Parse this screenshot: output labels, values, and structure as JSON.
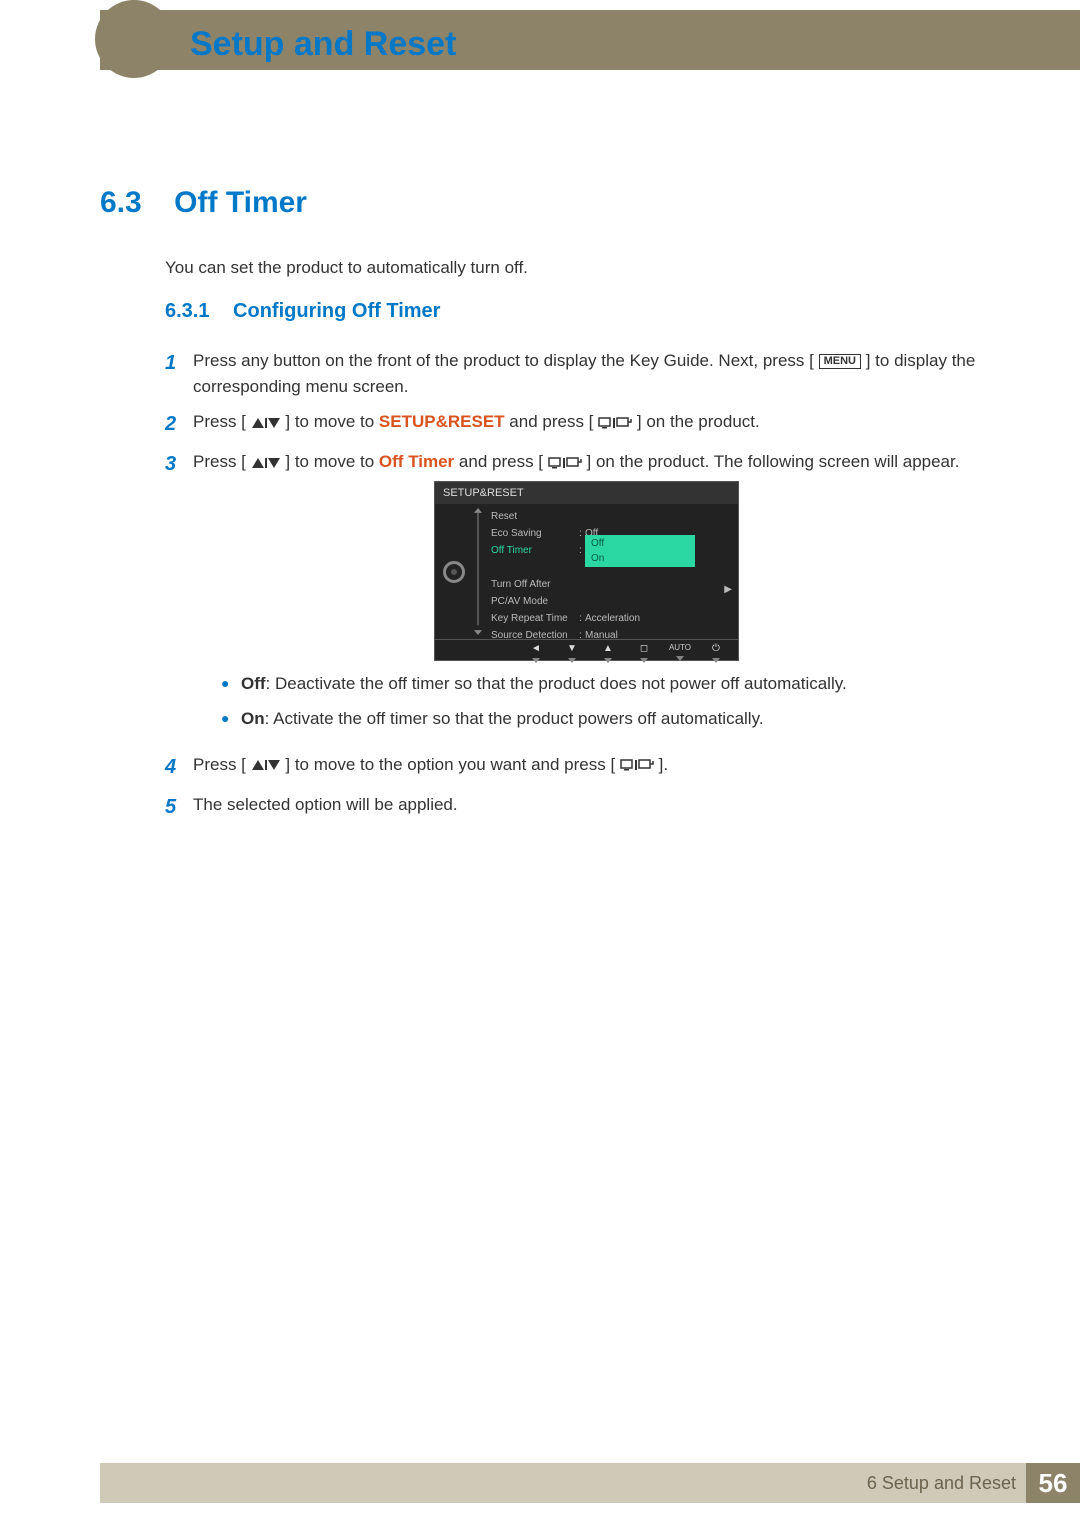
{
  "chapter_title": "Setup and Reset",
  "section": {
    "number": "6.3",
    "title": "Off Timer"
  },
  "intro": "You can set the product to automatically turn off.",
  "subsection": {
    "number": "6.3.1",
    "title": "Configuring Off Timer"
  },
  "steps": {
    "s1": {
      "num": "1",
      "pre": "Press any button on the front of the product to display the Key Guide. Next, press [",
      "menu": "MENU",
      "post": "] to display the corresponding menu screen."
    },
    "s2": {
      "num": "2",
      "pre": "Press [",
      "mid1": "] to move to ",
      "setup": "SETUP&RESET",
      "mid2": " and press [",
      "post": "] on the product."
    },
    "s3": {
      "num": "3",
      "pre": "Press [",
      "mid1": "] to move to ",
      "highlight": "Off Timer",
      "mid2": " and press [",
      "post": "] on the product. The following screen will appear."
    },
    "s4": {
      "num": "4",
      "pre": "Press [",
      "mid": "] to move to the option you want and press [",
      "post": "]."
    },
    "s5": {
      "num": "5",
      "text": "The selected option will be applied."
    }
  },
  "bullets": {
    "off": {
      "label": "Off",
      "text": ": Deactivate the off timer so that the product does not power off automatically."
    },
    "on": {
      "label": "On",
      "text": ": Activate the off timer so that the product powers off automatically."
    }
  },
  "osd": {
    "title": "SETUP&RESET",
    "items": {
      "reset": {
        "label": "Reset",
        "value": ""
      },
      "eco": {
        "label": "Eco Saving",
        "value": "Off"
      },
      "offtimer": {
        "label": "Off Timer",
        "opt_off": "Off",
        "opt_on": "On"
      },
      "turnoff": {
        "label": "Turn Off After",
        "value": ""
      },
      "pcav": {
        "label": "PC/AV Mode",
        "value": ""
      },
      "keyrepeat": {
        "label": "Key Repeat Time",
        "value": "Acceleration"
      },
      "source": {
        "label": "Source Detection",
        "value": "Manual"
      }
    },
    "foot_auto": "AUTO"
  },
  "footer": {
    "chapter_label": "6 Setup and Reset",
    "page_number": "56"
  }
}
